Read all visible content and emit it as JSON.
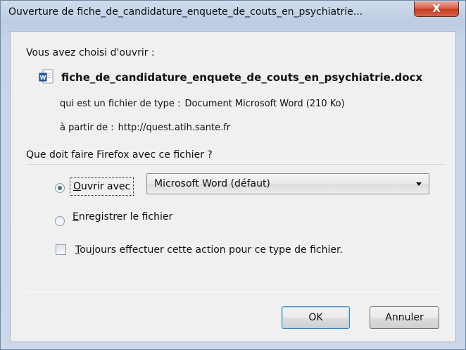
{
  "window": {
    "title": "Ouverture de fiche_de_candidature_enquete_de_couts_en_psychiatrie...",
    "close_label": "X"
  },
  "dialog": {
    "intro": "Vous avez choisi d'ouvrir :",
    "file_name": "fiche_de_candidature_enquete_de_couts_en_psychiatrie.docx",
    "file_icon": "word-document-icon",
    "type_label": "qui est un fichier de type :",
    "type_value": "Document Microsoft Word (210 Ko)",
    "from_label": "à partir de :",
    "from_value": "http://quest.atih.sante.fr",
    "question": "Que doit faire Firefox avec ce fichier ?",
    "open_with": {
      "access_key": "O",
      "rest": "uvrir avec",
      "selected": true,
      "app": "Microsoft Word (défaut)"
    },
    "save": {
      "access_key": "E",
      "rest": "nregistrer le fichier",
      "selected": false
    },
    "always": {
      "access_key": "T",
      "rest": "oujours effectuer cette action pour ce type de fichier.",
      "checked": false
    },
    "ok_label": "OK",
    "cancel_label": "Annuler"
  },
  "colors": {
    "title_bar": "#c6d5e8",
    "close_button": "#c63b22",
    "dialog_bg": "#f0f0f0",
    "default_button_border": "#3c7fb1"
  }
}
